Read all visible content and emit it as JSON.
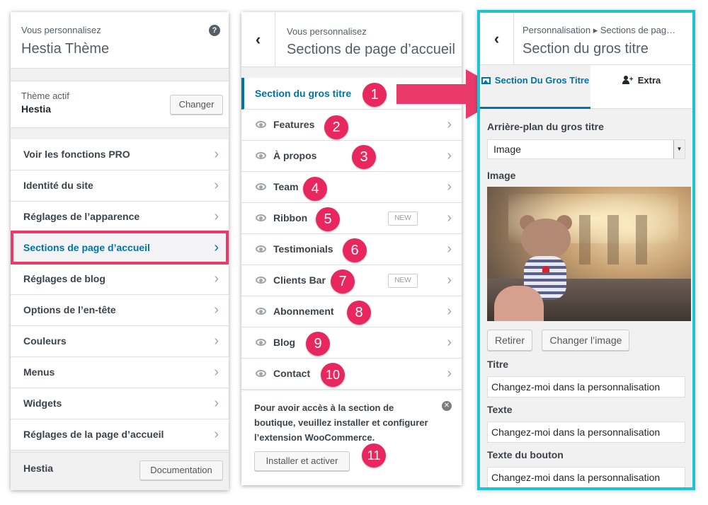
{
  "panel1": {
    "subtitle": "Vous personnalisez",
    "title": "Hestia Thème",
    "help_icon": "?",
    "active_theme_label": "Thème actif",
    "active_theme_name": "Hestia",
    "change_button": "Changer",
    "menu": [
      {
        "label": "Voir les fonctions PRO"
      },
      {
        "label": "Identité du site"
      },
      {
        "label": "Réglages de l’apparence"
      },
      {
        "label": "Sections de page d’accueil",
        "active": true
      },
      {
        "label": "Réglages de blog"
      },
      {
        "label": "Options de l’en-tête"
      },
      {
        "label": "Couleurs"
      },
      {
        "label": "Menus"
      },
      {
        "label": "Widgets"
      },
      {
        "label": "Réglages de la page d’accueil"
      }
    ],
    "footer_label": "Hestia",
    "documentation_button": "Documentation"
  },
  "panel2": {
    "back": "‹",
    "subtitle": "Vous personnalisez",
    "title": "Sections de page d’accueil",
    "first_item": "Section du gros titre",
    "items": [
      {
        "label": "Features",
        "number": "2"
      },
      {
        "label": "À propos",
        "number": "3"
      },
      {
        "label": "Team",
        "number": "4"
      },
      {
        "label": "Ribbon",
        "number": "5",
        "badge": "NEW"
      },
      {
        "label": "Testimonials",
        "number": "6"
      },
      {
        "label": "Clients Bar",
        "number": "7",
        "badge": "NEW"
      },
      {
        "label": "Abonnement",
        "number": "8"
      },
      {
        "label": "Blog",
        "number": "9"
      },
      {
        "label": "Contact",
        "number": "10"
      }
    ],
    "woo_notice": "Pour avoir accès à la section de boutique, veuillez installer et configurer l’extension WooCommerce.",
    "woo_close": "✕",
    "install_button": "Installer et activer",
    "number_first": "1",
    "number_woo": "11"
  },
  "panel3": {
    "back": "‹",
    "breadcrumb": "Personnalisation ▸ Sections de pag…",
    "title": "Section du gros titre",
    "tab_main": "Section Du Gros Titre",
    "tab_extra": "Extra",
    "background_label": "Arrière-plan du gros titre",
    "background_value": "Image",
    "image_label": "Image",
    "remove_button": "Retirer",
    "change_image_button": "Changer l’image",
    "title_label": "Titre",
    "title_value": "Changez-moi dans la personnalisation",
    "text_label": "Texte",
    "text_value": "Changez-moi dans la personnalisation",
    "button_text_label": "Texte du bouton",
    "button_text_value": "Changez-moi dans la personnalisation"
  },
  "colors": {
    "accent": "#0073aa",
    "highlight": "#ea3a6a",
    "number_badge": "#e9275f",
    "panel_border": "#21c2cf"
  }
}
